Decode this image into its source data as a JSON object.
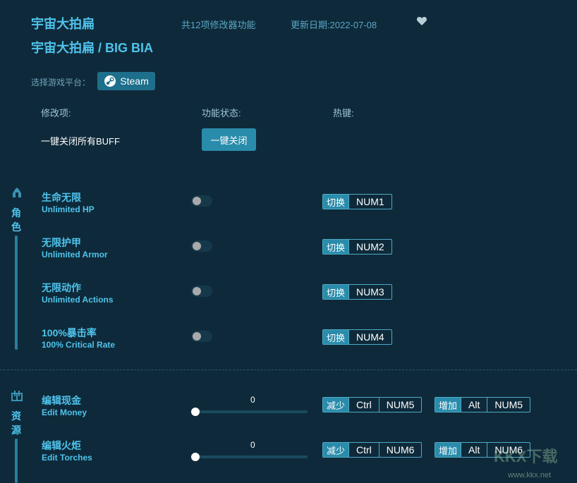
{
  "header": {
    "title_cn": "宇宙大拍扁",
    "title_full": "宇宙大拍扁 / BIG BIA",
    "feature_count": "共12项修改器功能",
    "update_date": "更新日期:2022-07-08"
  },
  "platform": {
    "label": "选择游戏平台：",
    "steam": "Steam"
  },
  "columns": {
    "item": "修改项:",
    "status": "功能状态:",
    "hotkey": "热键:"
  },
  "buff": {
    "label": "一键关闭所有BUFF",
    "button": "一键关闭"
  },
  "sections": {
    "role": {
      "c1": "角",
      "c2": "色"
    },
    "resource": {
      "c1": "资",
      "c2": "源"
    }
  },
  "toggle_items": [
    {
      "cn": "生命无限",
      "en": "Unlimited HP",
      "tag": "切换",
      "key": "NUM1"
    },
    {
      "cn": "无限护甲",
      "en": "Unlimited Armor",
      "tag": "切换",
      "key": "NUM2"
    },
    {
      "cn": "无限动作",
      "en": "Unlimited Actions",
      "tag": "切换",
      "key": "NUM3"
    },
    {
      "cn": "100%暴击率",
      "en": "100% Critical Rate",
      "tag": "切换",
      "key": "NUM4"
    }
  ],
  "slider_items": [
    {
      "cn": "编辑现金",
      "en": "Edit Money",
      "value": "0",
      "dec_tag": "减少",
      "dec_mod": "Ctrl",
      "dec_key": "NUM5",
      "inc_tag": "增加",
      "inc_mod": "Alt",
      "inc_key": "NUM5"
    },
    {
      "cn": "编辑火炬",
      "en": "Edit Torches",
      "value": "0",
      "dec_tag": "减少",
      "dec_mod": "Ctrl",
      "dec_key": "NUM6",
      "inc_tag": "增加",
      "inc_mod": "Alt",
      "inc_key": "NUM6"
    }
  ],
  "watermark": {
    "logo": "KKX下载",
    "url": "www.kkx.net"
  },
  "colors": {
    "background": "#0e2a3a",
    "accent": "#4fc3ec",
    "button": "#2a8cab"
  }
}
